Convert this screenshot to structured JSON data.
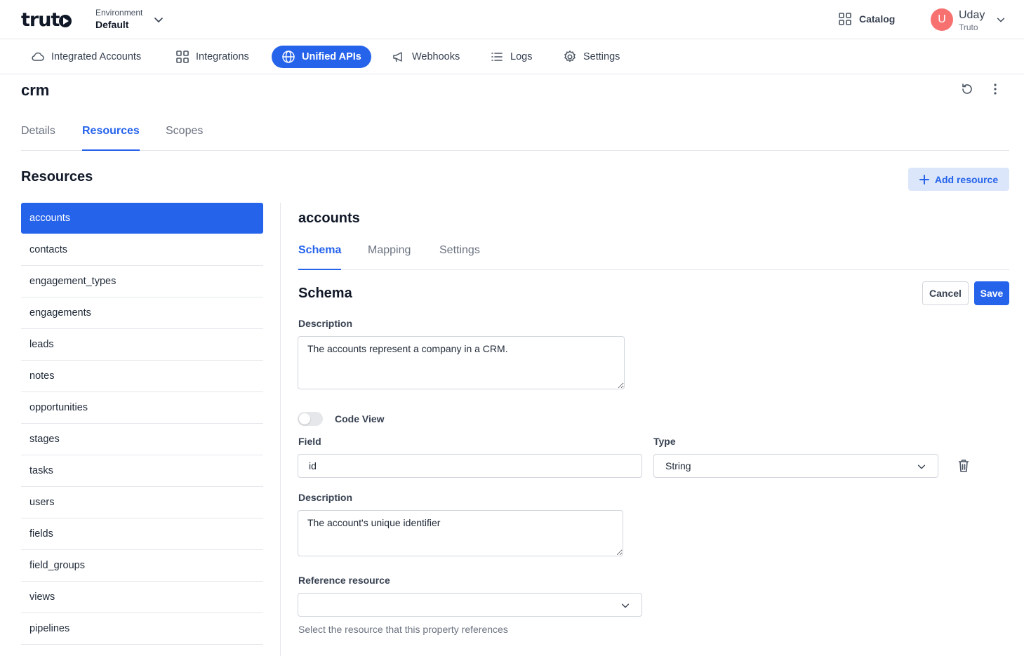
{
  "brand": {
    "logo_text": "trut"
  },
  "environment": {
    "label": "Environment",
    "value": "Default"
  },
  "header": {
    "catalog_label": "Catalog",
    "user_initial": "U",
    "user_name": "Uday",
    "user_org": "Truto"
  },
  "nav": {
    "items": [
      {
        "label": "Integrated Accounts",
        "icon": "cloud-icon"
      },
      {
        "label": "Integrations",
        "icon": "grid-icon"
      },
      {
        "label": "Unified APIs",
        "icon": "globe-icon",
        "active": true
      },
      {
        "label": "Webhooks",
        "icon": "megaphone-icon"
      },
      {
        "label": "Logs",
        "icon": "list-icon"
      },
      {
        "label": "Settings",
        "icon": "gear-icon"
      }
    ]
  },
  "page": {
    "title": "crm",
    "tabs": [
      "Details",
      "Resources",
      "Scopes"
    ],
    "active_tab": "Resources"
  },
  "resources": {
    "title": "Resources",
    "add_label": "Add resource",
    "items": [
      "accounts",
      "contacts",
      "engagement_types",
      "engagements",
      "leads",
      "notes",
      "opportunities",
      "stages",
      "tasks",
      "users",
      "fields",
      "field_groups",
      "views",
      "pipelines"
    ],
    "selected": "accounts"
  },
  "detail": {
    "title": "accounts",
    "tabs": [
      "Schema",
      "Mapping",
      "Settings"
    ],
    "active_tab": "Schema",
    "schema_title": "Schema",
    "cancel_label": "Cancel",
    "save_label": "Save",
    "description_label": "Description",
    "description_value": "The accounts represent a company in a CRM.",
    "code_view_label": "Code View",
    "field_label": "Field",
    "field_value": "id",
    "type_label": "Type",
    "type_value": "String",
    "field_description_label": "Description",
    "field_description_value": "The account's unique identifier",
    "reference_label": "Reference resource",
    "reference_value": "",
    "reference_helper": "Select the resource that this property references"
  },
  "colors": {
    "accent": "#2563eb",
    "avatar": "#f87171",
    "border": "#e5e7eb"
  }
}
